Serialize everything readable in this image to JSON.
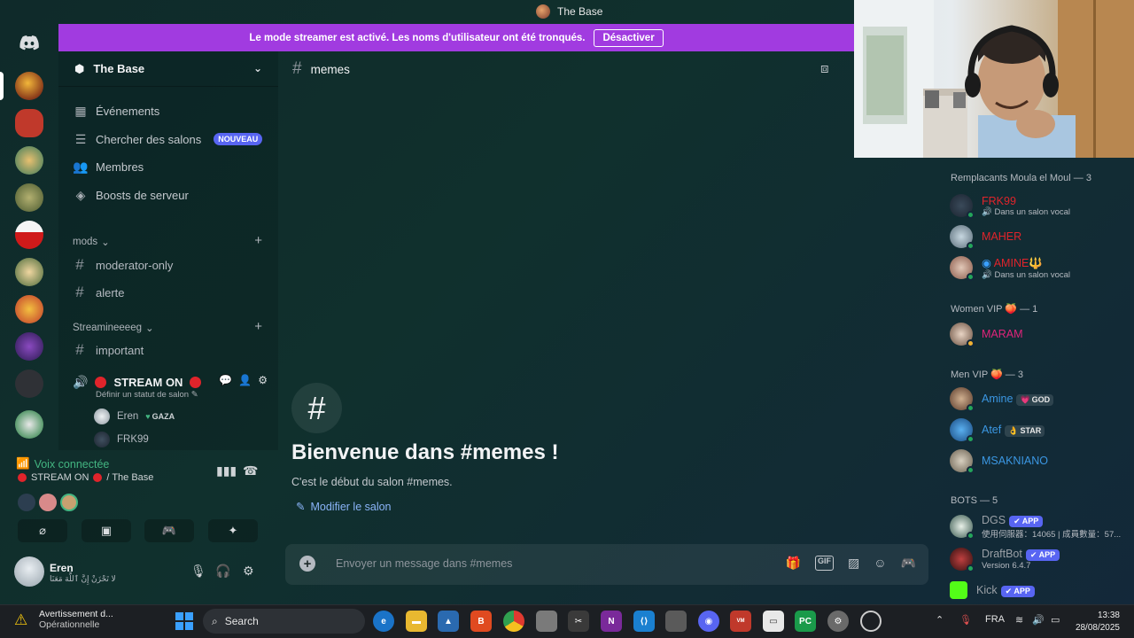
{
  "window": {
    "title": "The Base"
  },
  "banner": {
    "text": "Le mode streamer est activé. Les noms d'utilisateur ont été tronqués.",
    "button": "Désactiver"
  },
  "server": {
    "name": "The Base",
    "menu": [
      {
        "label": "Événements",
        "icon": "calendar-icon"
      },
      {
        "label": "Chercher des salons",
        "icon": "browse-channels-icon",
        "badge": "NOUVEAU"
      },
      {
        "label": "Membres",
        "icon": "members-icon"
      },
      {
        "label": "Boosts de serveur",
        "icon": "boost-icon"
      }
    ],
    "categories": [
      {
        "name": "mods",
        "channels": [
          "moderator-only",
          "alerte"
        ]
      },
      {
        "name": "Streamineeeeg",
        "channels": [
          "important"
        ]
      }
    ],
    "voice_channel": {
      "name": "STREAM ON",
      "status": "Définir un statut de salon",
      "users": [
        {
          "name": "Eren",
          "tag": "GAZA"
        },
        {
          "name": "FRK99"
        }
      ]
    }
  },
  "voice_connected": {
    "title": "Voix connectée",
    "channel": "STREAM ON",
    "server": "/ The Base"
  },
  "user": {
    "name": "Eren",
    "status": "لا تَحْزَنْ إِنَّ ٱللَّهَ مَعَنَا"
  },
  "chat": {
    "channel": "memes",
    "welcome_title": "Bienvenue dans #memes !",
    "welcome_sub": "C'est le début du salon #memes.",
    "edit_link": "Modifier le salon",
    "placeholder": "Envoyer un message dans #memes"
  },
  "members": {
    "groups": [
      {
        "title": "Remplacants Moula el Moul — 3",
        "members": [
          {
            "name": "FRK99",
            "sub": "Dans un salon vocal",
            "color": "#e0242b"
          },
          {
            "name": "MAHER",
            "color": "#e0242b"
          },
          {
            "name": "AMINE",
            "sub": "Dans un salon vocal",
            "color": "#e0242b",
            "emoji": "🔱"
          }
        ]
      },
      {
        "title": "Women VIP 🍑 — 1",
        "members": [
          {
            "name": "MARAM",
            "color": "#e0247a"
          }
        ]
      },
      {
        "title": "Men VIP 🍑 — 3",
        "members": [
          {
            "name": "Amine",
            "color": "#3b97e3",
            "tag": "GOD",
            "tag_icon": "💗"
          },
          {
            "name": "Atef",
            "color": "#3b97e3",
            "tag": "STAR",
            "tag_icon": "👌"
          },
          {
            "name": "MSAKNIANO",
            "color": "#3b97e3"
          }
        ]
      },
      {
        "title": "BOTS — 5",
        "members": [
          {
            "name": "DGS",
            "sub": "使用伺服器：14065 | 成員數量：57...",
            "color": "#9aa0a6",
            "app": "✔ APP"
          },
          {
            "name": "DraftBot",
            "sub": "Version 6.4.7",
            "color": "#9aa0a6",
            "app": "✔ APP"
          },
          {
            "name": "Kick",
            "color": "#9aa0a6",
            "app": "✔ APP"
          }
        ]
      }
    ]
  },
  "taskbar": {
    "notification_title": "Avertissement d...",
    "notification_sub": "Opérationnelle",
    "search": "Search",
    "lang": "FRA",
    "time": "13:38",
    "date": "28/08/2025"
  },
  "colors": {
    "accent": "#a13be0",
    "blurple": "#5865f2",
    "online": "#23a55a",
    "voice_green": "#43b581"
  }
}
